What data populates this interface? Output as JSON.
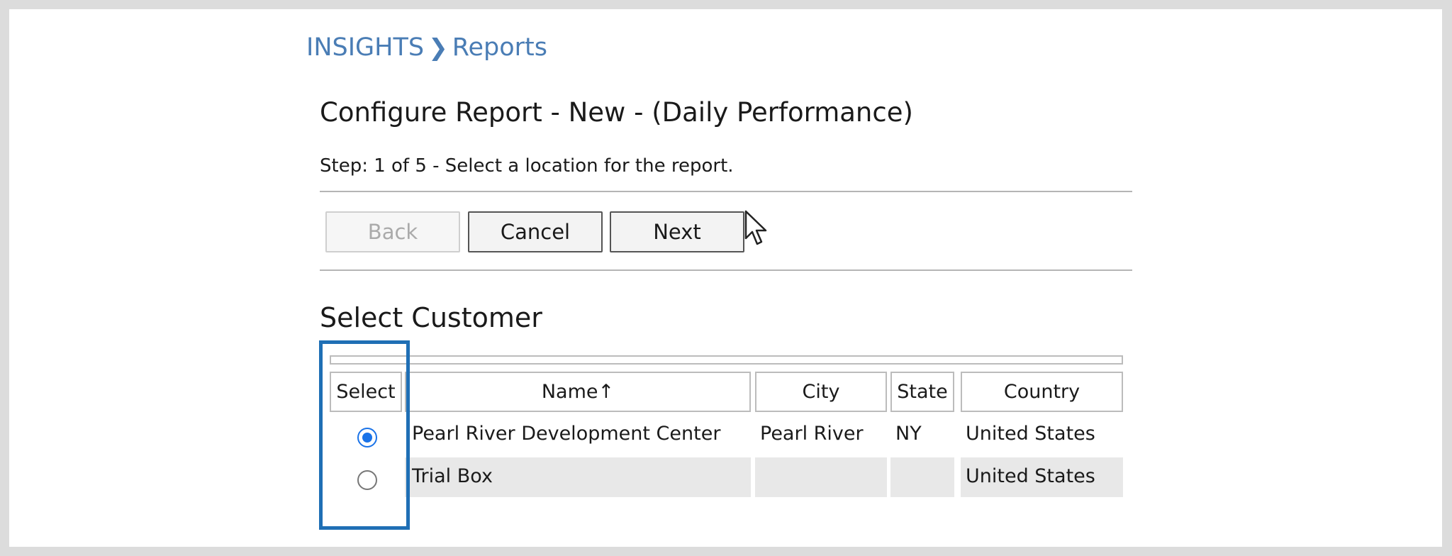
{
  "breadcrumb": {
    "root": "INSIGHTS",
    "separator": "❯",
    "current": "Reports"
  },
  "page_title": "Configure Report - New - (Daily Performance)",
  "step_text": "Step: 1 of 5 - Select a location for the report.",
  "buttons": {
    "back": "Back",
    "cancel": "Cancel",
    "next": "Next"
  },
  "section_title": "Select Customer",
  "table": {
    "headers": {
      "select": "Select",
      "name": "Name↑",
      "city": "City",
      "state": "State",
      "country": "Country"
    },
    "rows": [
      {
        "selected": true,
        "name": "Pearl River Development Center",
        "city": "Pearl River",
        "state": "NY",
        "country": "United States"
      },
      {
        "selected": false,
        "name": "Trial Box",
        "city": "",
        "state": "",
        "country": "United States"
      }
    ]
  },
  "colors": {
    "breadcrumb": "#4a7db5",
    "radio_selected": "#1a73e8",
    "highlight_box": "#1f6fb5",
    "alt_row": "#e8e8e8"
  }
}
